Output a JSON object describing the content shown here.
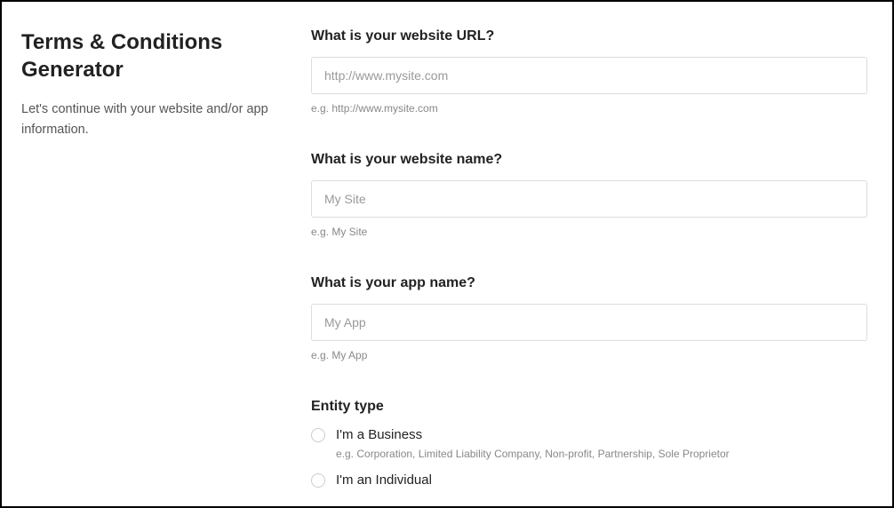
{
  "sidebar": {
    "title": "Terms & Conditions Generator",
    "subtitle": "Let's continue with your website and/or app information."
  },
  "form": {
    "website_url": {
      "label": "What is your website URL?",
      "placeholder": "http://www.mysite.com",
      "hint": "e.g. http://www.mysite.com"
    },
    "website_name": {
      "label": "What is your website name?",
      "placeholder": "My Site",
      "hint": "e.g. My Site"
    },
    "app_name": {
      "label": "What is your app name?",
      "placeholder": "My App",
      "hint": "e.g. My App"
    },
    "entity": {
      "label": "Entity type",
      "options": {
        "business": {
          "label": "I'm a Business",
          "hint": "e.g. Corporation, Limited Liability Company, Non-profit, Partnership, Sole Proprietor"
        },
        "individual": {
          "label": "I'm an Individual"
        }
      }
    }
  }
}
